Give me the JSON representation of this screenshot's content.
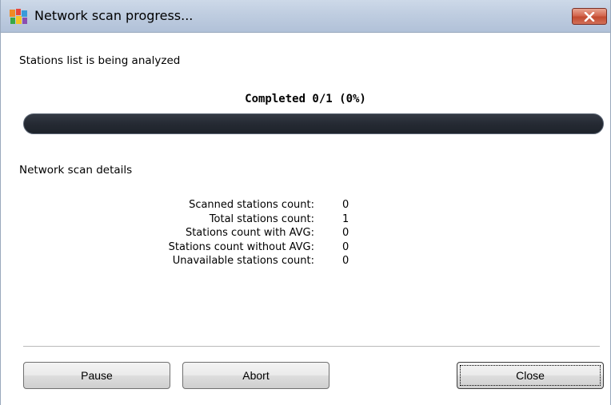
{
  "window": {
    "title": "Network scan progress..."
  },
  "status": {
    "message": "Stations list is being analyzed"
  },
  "progress": {
    "caption": "Completed 0/1 (0%)",
    "completed": 0,
    "total": 1,
    "fraction": 0
  },
  "details": {
    "heading": "Network scan details",
    "rows": [
      {
        "label": "Scanned stations count:",
        "value": "0"
      },
      {
        "label": "Total stations count:",
        "value": "1"
      },
      {
        "label": "Stations count with AVG:",
        "value": "0"
      },
      {
        "label": "Stations count without AVG:",
        "value": "0"
      },
      {
        "label": "Unavailable stations count:",
        "value": "0"
      }
    ]
  },
  "buttons": {
    "pause": "Pause",
    "abort": "Abort",
    "close": "Close"
  },
  "icons": {
    "app": "avg-logo-icon",
    "close": "close-icon"
  },
  "colors": {
    "progress_track": "#252a33",
    "close_button": "#c24a2f"
  }
}
